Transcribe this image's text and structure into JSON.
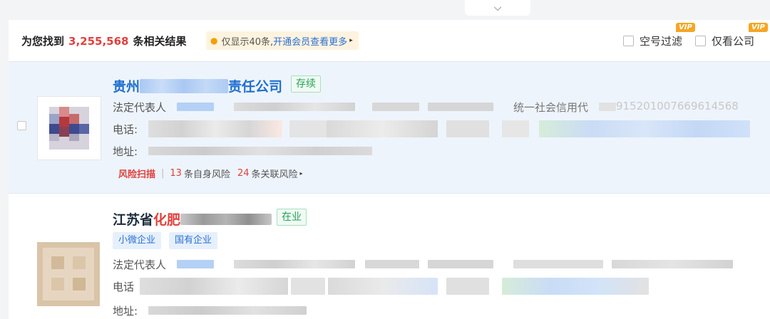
{
  "top_tab": {
    "icon": "chevron-down-icon",
    "glyph": "⌵"
  },
  "header": {
    "found_prefix": "为您找到",
    "count": "3,255,568",
    "found_suffix": "条相关结果",
    "notice_text": "仅显示40条,",
    "notice_link": "开通会员查看更多",
    "notice_arrow": "▸",
    "filter_empty_phone": "空号过滤",
    "filter_company_only": "仅看公司",
    "vip_badge": "VIP"
  },
  "results": [
    {
      "name_prefix": "贵州",
      "name_highlight": "",
      "name_suffix": "责任公司",
      "status": "存续",
      "legal_rep_label": "法定代表人",
      "credit_code_label": "统一社会信用代",
      "credit_code_value": "915201007669614568",
      "phone_label": "电话:",
      "address_label": "地址:",
      "risk": {
        "title": "风险扫描",
        "self_count": "13",
        "self_label": "条自身风险",
        "related_count": "24",
        "related_label": "条关联风险",
        "arrow": "▸"
      }
    },
    {
      "name_prefix": "江苏省",
      "name_highlight": "化肥",
      "name_suffix": "",
      "status": "在业",
      "tags": [
        "小微企业",
        "国有企业"
      ],
      "legal_rep_label": "法定代表人",
      "phone_label": "电话",
      "address_label": "地址:"
    }
  ],
  "colors": {
    "accent_red": "#e1403c",
    "link_blue": "#2b6fd6",
    "status_green": "#23a456",
    "vip_orange": "#f5a623",
    "selected_row_bg": "#eef4fc"
  }
}
